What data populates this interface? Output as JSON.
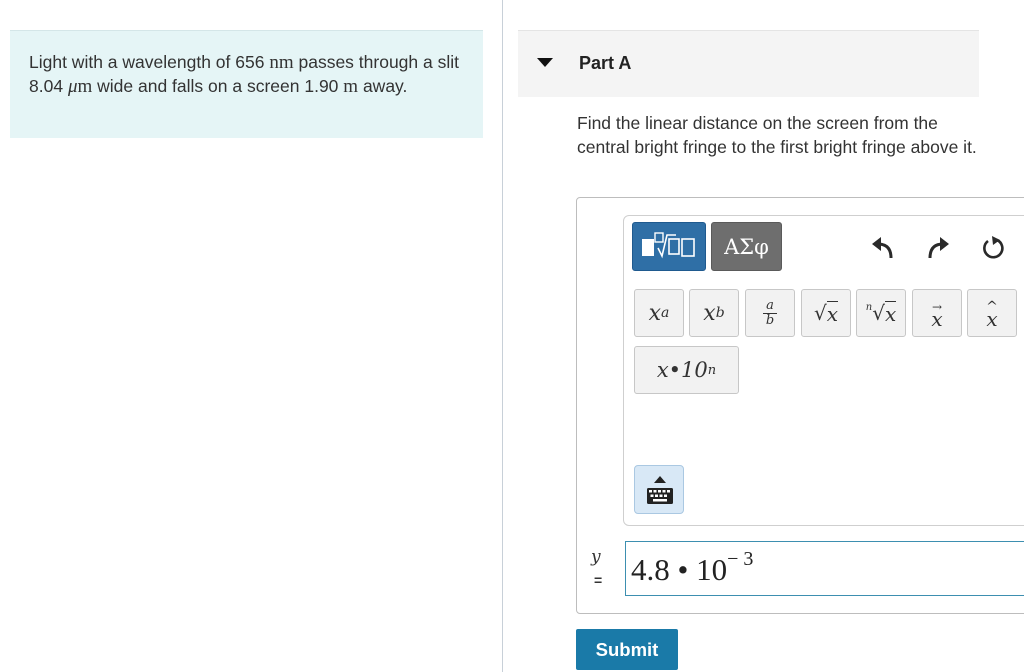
{
  "problem": {
    "intro": "Light with a wavelength of 656",
    "unit_nm": "nm",
    "mid1": "passes through a slit 8.04",
    "unit_mu": "μ",
    "unit_m1": "m",
    "mid2": "wide and falls on a screen 1.90",
    "unit_m2": "m",
    "end": "away."
  },
  "part": {
    "title": "Part A"
  },
  "question": "Find the linear distance on the screen from the central bright fringe to the first bright fringe above it.",
  "toolbar": {
    "greek_label": "ΑΣφ",
    "buttons": {
      "superscript_base": "x",
      "superscript_exp": "a",
      "subscript_base": "x",
      "subscript_sub": "b",
      "frac_num": "a",
      "frac_den": "b",
      "sqrt_arg": "x",
      "nthroot_index": "n",
      "nthroot_arg": "x",
      "vector_arg": "x",
      "hat_arg": "x",
      "sci_notation": "x•10",
      "sci_exp": "n"
    },
    "icons": [
      "templates-icon",
      "undo-icon",
      "redo-icon",
      "reset-icon",
      "keyboard-icon"
    ]
  },
  "answer": {
    "variable": "y",
    "equals": "=",
    "mantissa": "4.8 • 10",
    "exponent": "− 3"
  },
  "submit_label": "Submit",
  "colors": {
    "accent": "#1a7aa8",
    "problem_bg": "#e5f5f6",
    "greek_tab": "#6e6e6e",
    "templates_tab": "#2f6fa6"
  }
}
